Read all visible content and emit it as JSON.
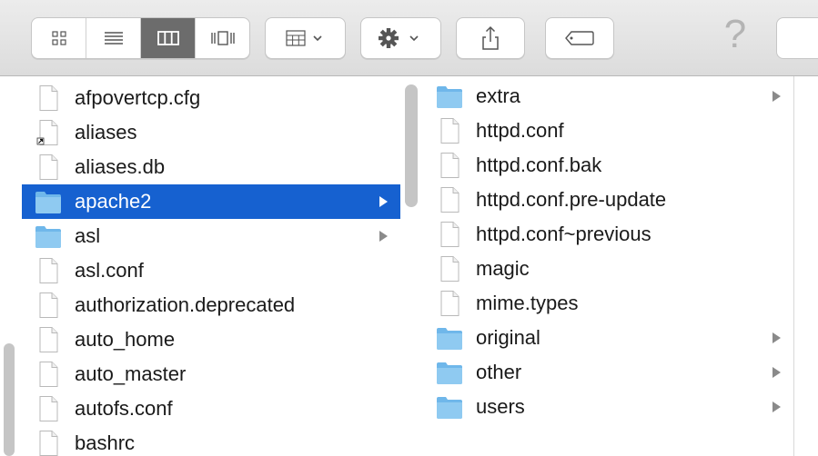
{
  "toolbar": {
    "view_buttons": [
      "icon-view",
      "list-view",
      "column-view",
      "cover-flow-view"
    ],
    "active_view": "column-view",
    "arrange_icon": "arrange-icon",
    "action_icon": "gear-icon",
    "share_icon": "share-icon",
    "tag_icon": "tag-icon",
    "help_label": "?"
  },
  "columns": {
    "left": [
      {
        "name": "afpovertcp.cfg",
        "type": "file"
      },
      {
        "name": "aliases",
        "type": "alias"
      },
      {
        "name": "aliases.db",
        "type": "file"
      },
      {
        "name": "apache2",
        "type": "folder",
        "selected": true
      },
      {
        "name": "asl",
        "type": "folder"
      },
      {
        "name": "asl.conf",
        "type": "file"
      },
      {
        "name": "authorization.deprecated",
        "type": "file"
      },
      {
        "name": "auto_home",
        "type": "file"
      },
      {
        "name": "auto_master",
        "type": "file"
      },
      {
        "name": "autofs.conf",
        "type": "file"
      },
      {
        "name": "bashrc",
        "type": "file"
      }
    ],
    "right": [
      {
        "name": "extra",
        "type": "folder"
      },
      {
        "name": "httpd.conf",
        "type": "file"
      },
      {
        "name": "httpd.conf.bak",
        "type": "file"
      },
      {
        "name": "httpd.conf.pre-update",
        "type": "file"
      },
      {
        "name": "httpd.conf~previous",
        "type": "file"
      },
      {
        "name": "magic",
        "type": "file"
      },
      {
        "name": "mime.types",
        "type": "file"
      },
      {
        "name": "original",
        "type": "folder"
      },
      {
        "name": "other",
        "type": "folder"
      },
      {
        "name": "users",
        "type": "folder"
      }
    ]
  },
  "colors": {
    "selection": "#1661d0",
    "folder": "#6fb7ea"
  }
}
